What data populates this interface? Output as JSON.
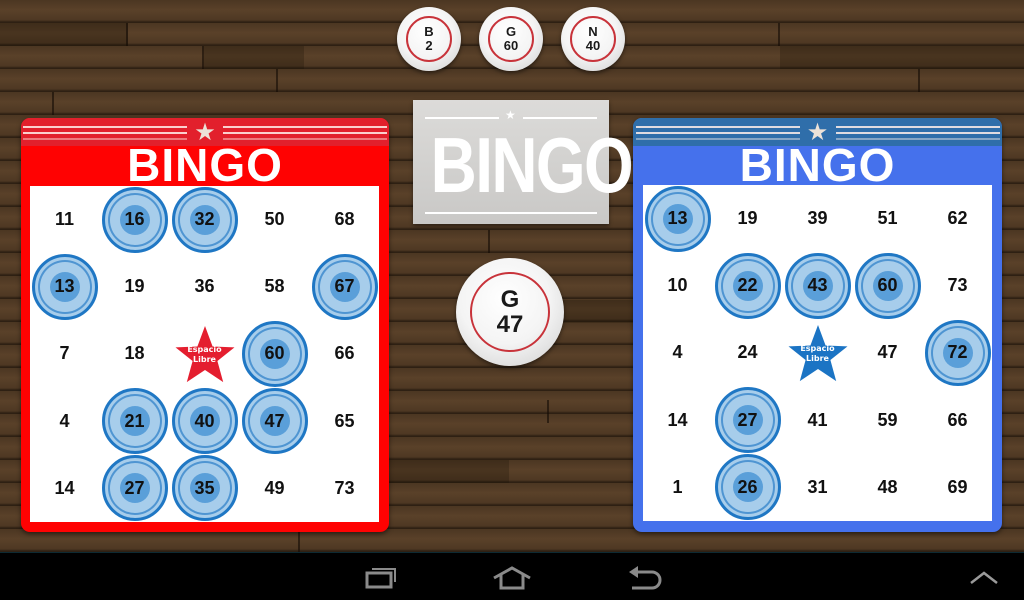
{
  "recent_balls": [
    {
      "letter": "B",
      "number": "2"
    },
    {
      "letter": "G",
      "number": "60"
    },
    {
      "letter": "N",
      "number": "40"
    }
  ],
  "current_ball": {
    "letter": "G",
    "number": "47"
  },
  "logo": {
    "text": "BINGO"
  },
  "free_space_label": [
    "Espacio",
    "Libre"
  ],
  "cards": [
    {
      "id": "red",
      "title": "BINGO",
      "color": "#ff0202",
      "rows": [
        [
          {
            "n": "11",
            "m": false
          },
          {
            "n": "16",
            "m": true
          },
          {
            "n": "32",
            "m": true
          },
          {
            "n": "50",
            "m": false
          },
          {
            "n": "68",
            "m": false
          }
        ],
        [
          {
            "n": "13",
            "m": true
          },
          {
            "n": "19",
            "m": false
          },
          {
            "n": "36",
            "m": false
          },
          {
            "n": "58",
            "m": false
          },
          {
            "n": "67",
            "m": true
          }
        ],
        [
          {
            "n": "7",
            "m": false
          },
          {
            "n": "18",
            "m": false
          },
          {
            "n": "FREE",
            "m": false
          },
          {
            "n": "60",
            "m": true
          },
          {
            "n": "66",
            "m": false
          }
        ],
        [
          {
            "n": "4",
            "m": false
          },
          {
            "n": "21",
            "m": true
          },
          {
            "n": "40",
            "m": true
          },
          {
            "n": "47",
            "m": true
          },
          {
            "n": "65",
            "m": false
          }
        ],
        [
          {
            "n": "14",
            "m": false
          },
          {
            "n": "27",
            "m": true
          },
          {
            "n": "35",
            "m": true
          },
          {
            "n": "49",
            "m": false
          },
          {
            "n": "73",
            "m": false
          }
        ]
      ],
      "free_star_color": "#e41e2f"
    },
    {
      "id": "blue",
      "title": "BINGO",
      "color": "#4571ec",
      "rows": [
        [
          {
            "n": "13",
            "m": true
          },
          {
            "n": "19",
            "m": false
          },
          {
            "n": "39",
            "m": false
          },
          {
            "n": "51",
            "m": false
          },
          {
            "n": "62",
            "m": false
          }
        ],
        [
          {
            "n": "10",
            "m": false
          },
          {
            "n": "22",
            "m": true
          },
          {
            "n": "43",
            "m": true
          },
          {
            "n": "60",
            "m": true
          },
          {
            "n": "73",
            "m": false
          }
        ],
        [
          {
            "n": "4",
            "m": false
          },
          {
            "n": "24",
            "m": false
          },
          {
            "n": "FREE",
            "m": false
          },
          {
            "n": "47",
            "m": false
          },
          {
            "n": "72",
            "m": true
          }
        ],
        [
          {
            "n": "14",
            "m": false
          },
          {
            "n": "27",
            "m": true
          },
          {
            "n": "41",
            "m": false
          },
          {
            "n": "59",
            "m": false
          },
          {
            "n": "66",
            "m": false
          }
        ],
        [
          {
            "n": "1",
            "m": false
          },
          {
            "n": "26",
            "m": true
          },
          {
            "n": "31",
            "m": false
          },
          {
            "n": "48",
            "m": false
          },
          {
            "n": "69",
            "m": false
          }
        ]
      ],
      "free_star_color": "#1b74c4"
    }
  ],
  "navbar": {
    "buttons": [
      {
        "name": "recent-apps-icon"
      },
      {
        "name": "home-icon"
      },
      {
        "name": "back-icon"
      },
      {
        "name": "chevron-up-icon"
      }
    ]
  }
}
